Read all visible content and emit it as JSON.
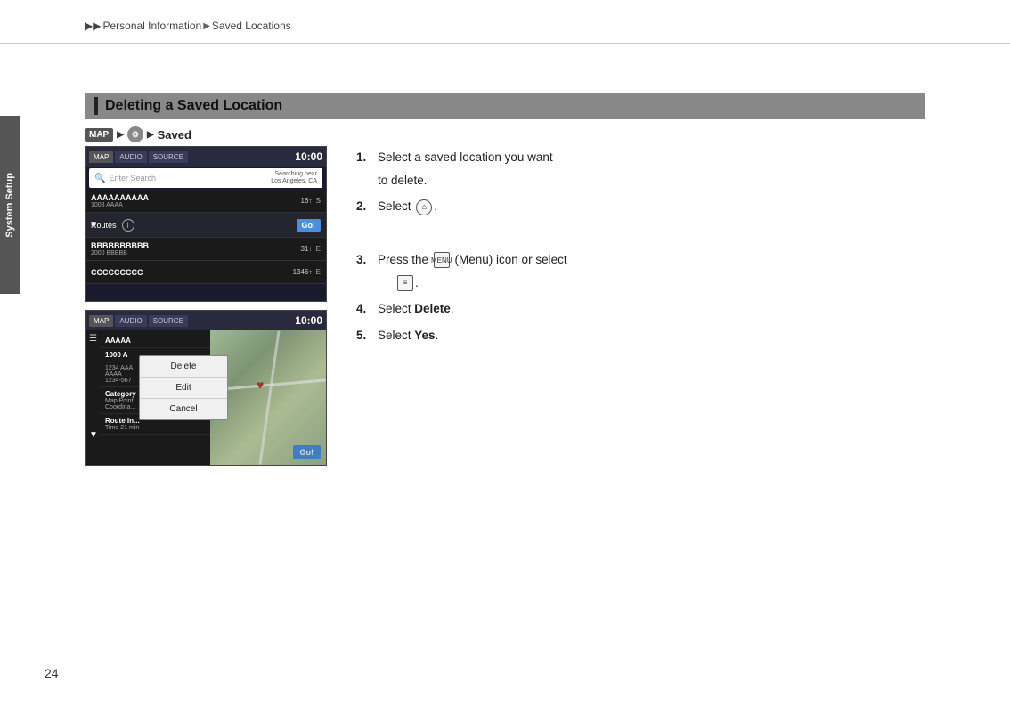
{
  "breadcrumb": {
    "parts": [
      "Personal Information",
      "Saved Locations"
    ],
    "sep": "▶"
  },
  "side_tab": {
    "label": "System Setup"
  },
  "section": {
    "title": "Deleting a Saved Location"
  },
  "nav_path": {
    "map_label": "MAP",
    "arrow": "▶",
    "saved_label": "Saved"
  },
  "screen1": {
    "tabs": [
      "MAP",
      "AUDIO",
      "SOURCE"
    ],
    "time": "10:00",
    "search_placeholder": "Enter Search",
    "search_near": "Searching near\nLos Angeles, CA",
    "items": [
      {
        "title": "AAAAAAAAAA",
        "sub": "1008 AAAA",
        "dist": "16↑",
        "dir": "S"
      },
      {
        "label1": "Routes",
        "label2": "Go!"
      },
      {
        "title": "BBBBBBBBBB",
        "sub": "2000 BBBBB",
        "dist": "31↑",
        "dir": "E"
      },
      {
        "title": "CCCCCCCCC",
        "sub": "",
        "dist": "1346↑",
        "dir": "E"
      }
    ]
  },
  "screen2": {
    "tabs": [
      "MAP",
      "AUDIO",
      "SOURCE"
    ],
    "time": "10:00",
    "left_items": [
      {
        "title": "AAAAA",
        "sub": ""
      },
      {
        "title": "1000 A",
        "sub": ""
      },
      {
        "title": "1234 AAA",
        "sub": "AAAA\n1234-567"
      },
      {
        "title": "Category",
        "sub": "Map Point\nCoordina..."
      },
      {
        "title": "Route In...",
        "sub": "Time 21 min"
      }
    ],
    "context_menu": {
      "items": [
        "Delete",
        "Edit",
        "Cancel"
      ]
    }
  },
  "instructions": {
    "step1_num": "1.",
    "step1_text": "Select a saved location you want\nto delete.",
    "step2_num": "2.",
    "step2_text": "Select",
    "step2_icon": "⌂",
    "step3_num": "3.",
    "step3_text": "Press the",
    "step3_icon": "MENU",
    "step3_text2": "(Menu) icon or select",
    "step3_icon2": "≡",
    "step4_num": "4.",
    "step4_text": "Select",
    "step4_bold": "Delete",
    "step4_period": ".",
    "step5_num": "5.",
    "step5_text": "Select",
    "step5_bold": "Yes",
    "step5_period": "."
  },
  "page_number": "24"
}
